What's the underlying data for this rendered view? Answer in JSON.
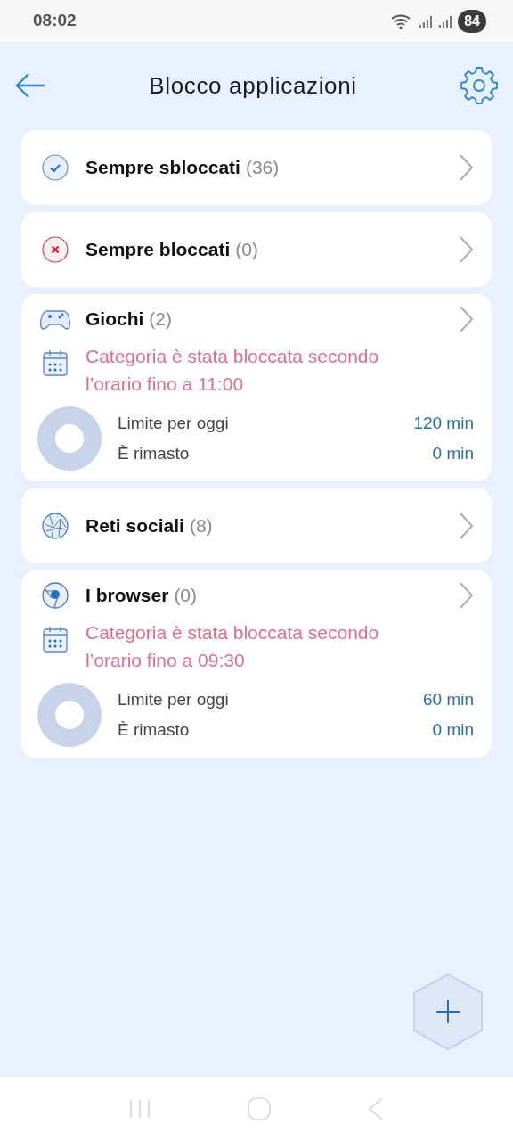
{
  "status_bar": {
    "time": "08:02",
    "battery": "84"
  },
  "header": {
    "title": "Blocco applicazioni"
  },
  "categories": [
    {
      "kind": "unblocked",
      "name": "Sempre sbloccati",
      "count": "(36)"
    },
    {
      "kind": "blocked",
      "name": "Sempre bloccati",
      "count": "(0)"
    },
    {
      "kind": "games",
      "name": "Giochi",
      "count": "(2)",
      "schedule": "Categoria è stata bloccata secondo l’orario fino a 11:00",
      "limit_label": "Limite per oggi",
      "limit_value": "120 min",
      "remaining_label": "È rimasto",
      "remaining_value": "0 min"
    },
    {
      "kind": "social",
      "name": "Reti sociali",
      "count": "(8)"
    },
    {
      "kind": "browser",
      "name": "I browser",
      "count": "(0)",
      "schedule": "Categoria è stata bloccata secondo l’orario fino a 09:30",
      "limit_label": "Limite per oggi",
      "limit_value": "60 min",
      "remaining_label": "È rimasto",
      "remaining_value": "0 min"
    }
  ]
}
